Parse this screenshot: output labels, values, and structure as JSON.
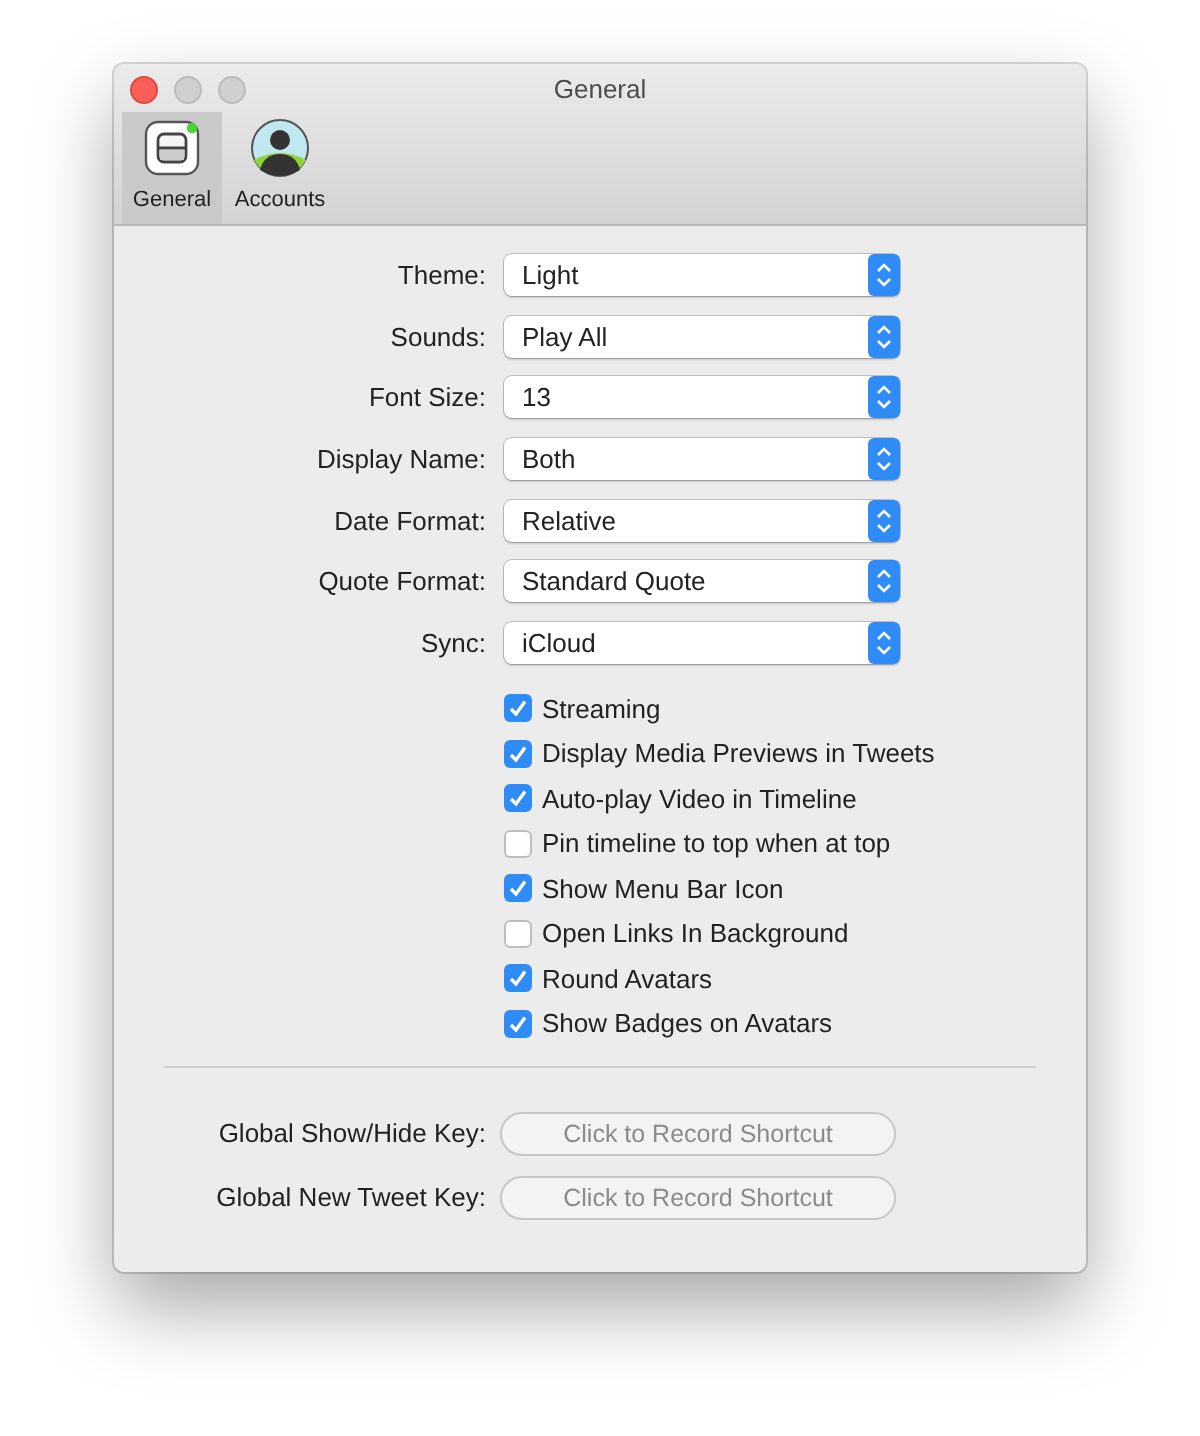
{
  "window": {
    "title": "General"
  },
  "tabs": [
    {
      "label": "General",
      "kind": "general",
      "selected": true
    },
    {
      "label": "Accounts",
      "kind": "accounts",
      "selected": false
    }
  ],
  "popups": [
    {
      "label": "Theme:",
      "value": "Light"
    },
    {
      "label": "Sounds:",
      "value": "Play All"
    },
    {
      "label": "Font Size:",
      "value": "13"
    },
    {
      "label": "Display Name:",
      "value": "Both"
    },
    {
      "label": "Date Format:",
      "value": "Relative"
    },
    {
      "label": "Quote Format:",
      "value": "Standard Quote"
    },
    {
      "label": "Sync:",
      "value": "iCloud"
    }
  ],
  "checkboxes": [
    {
      "label": "Streaming",
      "checked": true
    },
    {
      "label": "Display Media Previews in Tweets",
      "checked": true
    },
    {
      "label": "Auto-play Video in Timeline",
      "checked": true
    },
    {
      "label": "Pin timeline to top when at top",
      "checked": false
    },
    {
      "label": "Show Menu Bar Icon",
      "checked": true
    },
    {
      "label": "Open Links In Background",
      "checked": false
    },
    {
      "label": "Round Avatars",
      "checked": true
    },
    {
      "label": "Show Badges on Avatars",
      "checked": true
    }
  ],
  "shortcuts": [
    {
      "label": "Global Show/Hide Key:",
      "button": "Click to Record Shortcut"
    },
    {
      "label": "Global New Tweet Key:",
      "button": "Click to Record Shortcut"
    }
  ]
}
